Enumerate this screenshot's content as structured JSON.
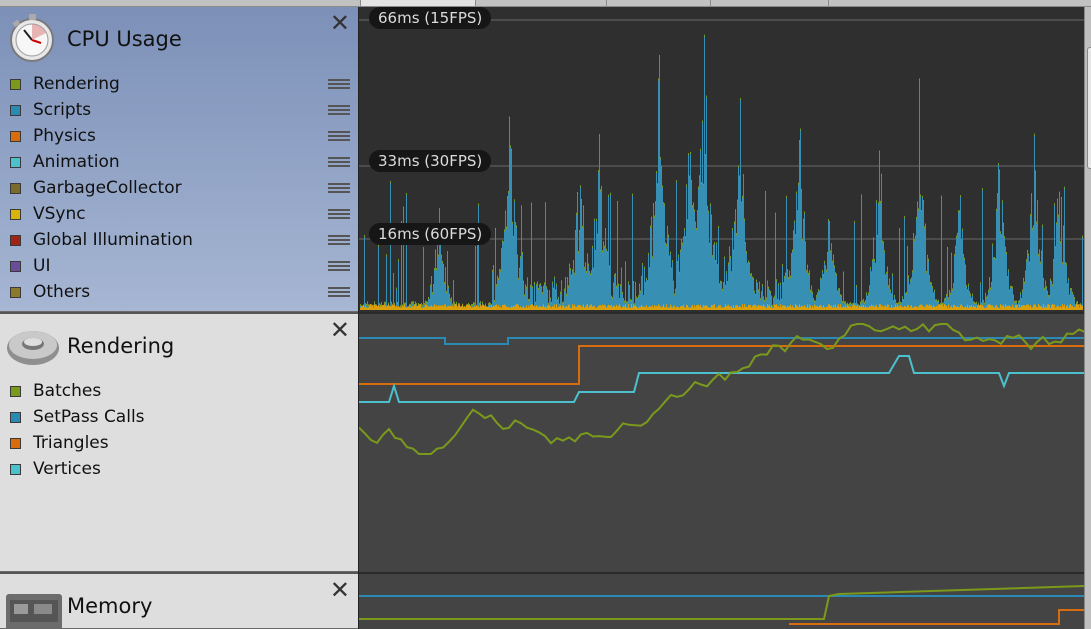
{
  "modules": {
    "cpu": {
      "title": "CPU Usage",
      "close_glyph": "✕",
      "icon": "stopwatch-icon",
      "items": [
        {
          "label": "Rendering",
          "color": "#7b9a1c"
        },
        {
          "label": "Scripts",
          "color": "#2a8ab4"
        },
        {
          "label": "Physics",
          "color": "#d96c0c"
        },
        {
          "label": "Animation",
          "color": "#4cc0cc"
        },
        {
          "label": "GarbageCollector",
          "color": "#7a6a2c"
        },
        {
          "label": "VSync",
          "color": "#d9b40c"
        },
        {
          "label": "Global Illumination",
          "color": "#a02416"
        },
        {
          "label": "UI",
          "color": "#6a4c9a"
        },
        {
          "label": "Others",
          "color": "#8a7a2c"
        }
      ],
      "markers": [
        "66ms (15FPS)",
        "33ms (30FPS)",
        "16ms (60FPS)"
      ]
    },
    "rendering": {
      "title": "Rendering",
      "close_glyph": "✕",
      "icon": "torus-icon",
      "items": [
        {
          "label": "Batches",
          "color": "#7b9a1c"
        },
        {
          "label": "SetPass Calls",
          "color": "#2a8ab4"
        },
        {
          "label": "Triangles",
          "color": "#d96c0c"
        },
        {
          "label": "Vertices",
          "color": "#4cc0cc"
        }
      ]
    },
    "memory": {
      "title": "Memory",
      "close_glyph": "✕",
      "icon": "memory-chip-icon"
    }
  }
}
